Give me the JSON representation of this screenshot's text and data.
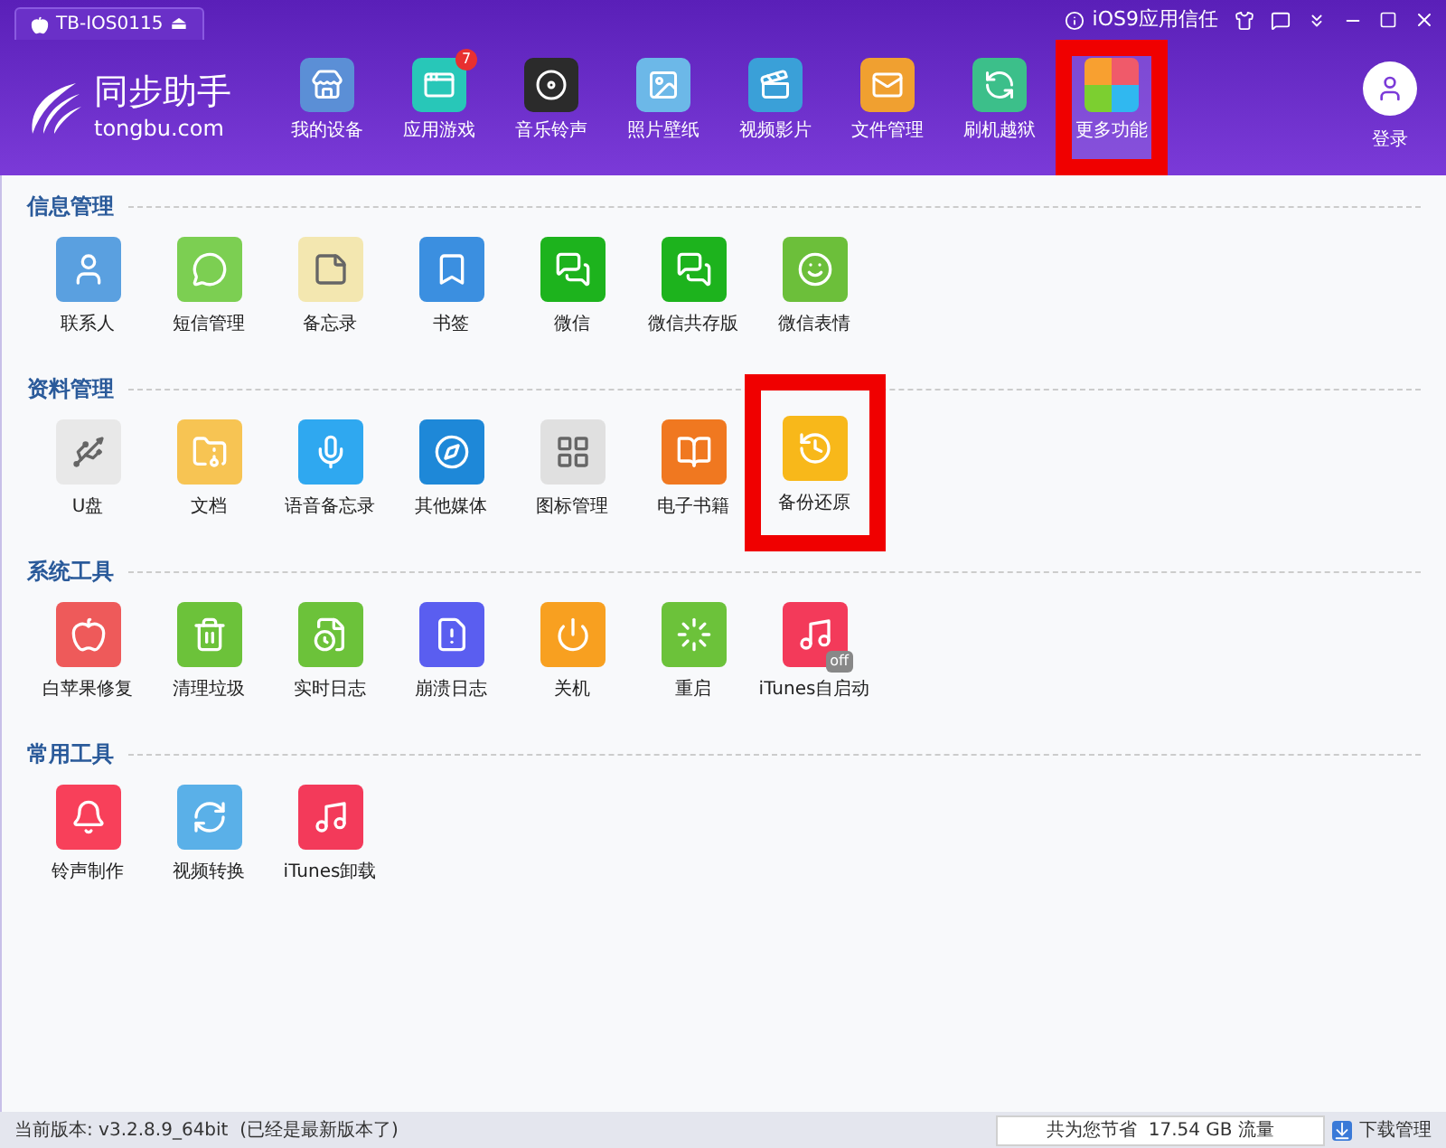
{
  "title_bar": {
    "device_tab": "TB-IOS0115",
    "eject": "⏏",
    "trust_link": "iOS9应用信任"
  },
  "logo": {
    "name": "同步助手",
    "domain": "tongbu.com"
  },
  "nav": [
    {
      "label": "我的设备",
      "selected": false,
      "highlighted": false
    },
    {
      "label": "应用游戏",
      "selected": false,
      "highlighted": false,
      "badge": "7"
    },
    {
      "label": "音乐铃声",
      "selected": false,
      "highlighted": false
    },
    {
      "label": "照片壁纸",
      "selected": false,
      "highlighted": false
    },
    {
      "label": "视频影片",
      "selected": false,
      "highlighted": false
    },
    {
      "label": "文件管理",
      "selected": false,
      "highlighted": false
    },
    {
      "label": "刷机越狱",
      "selected": false,
      "highlighted": false
    },
    {
      "label": "更多功能",
      "selected": true,
      "highlighted": true
    }
  ],
  "login": {
    "label": "登录"
  },
  "sections": [
    {
      "title": "信息管理",
      "tools": [
        {
          "label": "联系人",
          "highlighted": false
        },
        {
          "label": "短信管理",
          "highlighted": false
        },
        {
          "label": "备忘录",
          "highlighted": false
        },
        {
          "label": "书签",
          "highlighted": false
        },
        {
          "label": "微信",
          "highlighted": false
        },
        {
          "label": "微信共存版",
          "highlighted": false
        },
        {
          "label": "微信表情",
          "highlighted": false
        }
      ]
    },
    {
      "title": "资料管理",
      "tools": [
        {
          "label": "U盘",
          "highlighted": false
        },
        {
          "label": "文档",
          "highlighted": false
        },
        {
          "label": "语音备忘录",
          "highlighted": false
        },
        {
          "label": "其他媒体",
          "highlighted": false
        },
        {
          "label": "图标管理",
          "highlighted": false
        },
        {
          "label": "电子书籍",
          "highlighted": false
        },
        {
          "label": "备份还原",
          "highlighted": true
        }
      ]
    },
    {
      "title": "系统工具",
      "tools": [
        {
          "label": "白苹果修复",
          "highlighted": false
        },
        {
          "label": "清理垃圾",
          "highlighted": false
        },
        {
          "label": "实时日志",
          "highlighted": false
        },
        {
          "label": "崩溃日志",
          "highlighted": false
        },
        {
          "label": "关机",
          "highlighted": false
        },
        {
          "label": "重启",
          "highlighted": false
        },
        {
          "label": "iTunes自启动",
          "highlighted": false,
          "badge": "off"
        }
      ]
    },
    {
      "title": "常用工具",
      "tools": [
        {
          "label": "铃声制作",
          "highlighted": false
        },
        {
          "label": "视频转换",
          "highlighted": false
        },
        {
          "label": "iTunes卸载",
          "highlighted": false
        }
      ]
    }
  ],
  "status_bar": {
    "version": "当前版本: v3.2.8.9_64bit  (已经是最新版本了)",
    "savings": "共为您节省  17.54 GB 流量",
    "downloads": "下载管理"
  }
}
